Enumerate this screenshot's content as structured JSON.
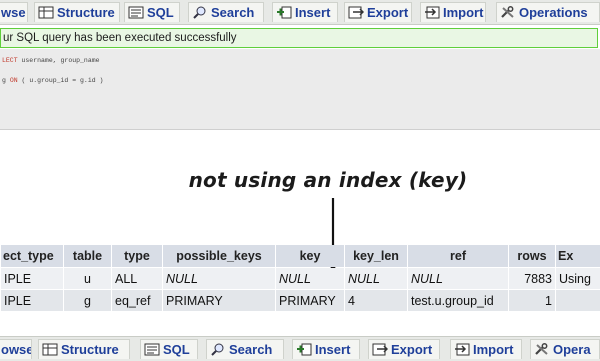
{
  "top_tabs": [
    {
      "label": "wse",
      "icon": "browse-icon"
    },
    {
      "label": "Structure",
      "icon": "structure-icon"
    },
    {
      "label": "SQL",
      "icon": "sql-icon"
    },
    {
      "label": "Search",
      "icon": "search-icon"
    },
    {
      "label": "Insert",
      "icon": "insert-icon"
    },
    {
      "label": "Export",
      "icon": "export-icon"
    },
    {
      "label": "Import",
      "icon": "import-icon"
    },
    {
      "label": "Operations",
      "icon": "operations-icon"
    }
  ],
  "bottom_tabs": [
    {
      "label": "owse",
      "icon": "browse-icon"
    },
    {
      "label": "Structure",
      "icon": "structure-icon"
    },
    {
      "label": "SQL",
      "icon": "sql-icon"
    },
    {
      "label": "Search",
      "icon": "search-icon"
    },
    {
      "label": "Insert",
      "icon": "insert-icon"
    },
    {
      "label": "Export",
      "icon": "export-icon"
    },
    {
      "label": "Import",
      "icon": "import-icon"
    },
    {
      "label": "Opera",
      "icon": "operations-icon"
    }
  ],
  "notice": {
    "text": "ur SQL query has been executed successfully",
    "accent": "#5fcf3b",
    "background": "#e9f7e4"
  },
  "sql": {
    "line1_keyword": "LECT",
    "line1_rest": " username, group_name",
    "line2_start": "g ",
    "line2_keyword": "ON",
    "line2_rest": " ( u.group_id = g.id )"
  },
  "annotation": {
    "text": "not using an index (key)"
  },
  "explain_table": {
    "columns": [
      "ect_type",
      "table",
      "type",
      "possible_keys",
      "key",
      "key_len",
      "ref",
      "rows",
      "Ex"
    ],
    "rows": [
      [
        "IPLE",
        "u",
        "ALL",
        "NULL",
        "NULL",
        "NULL",
        "NULL",
        "7883",
        "Using"
      ],
      [
        "IPLE",
        "g",
        "eq_ref",
        "PRIMARY",
        "PRIMARY",
        "4",
        "test.u.group_id",
        "1",
        ""
      ]
    ]
  },
  "colors": {
    "tab_text": "#1f3f9a",
    "header_bg": "#d8dde6",
    "row_even": "#eef0f3",
    "row_odd": "#e3e6ea"
  }
}
